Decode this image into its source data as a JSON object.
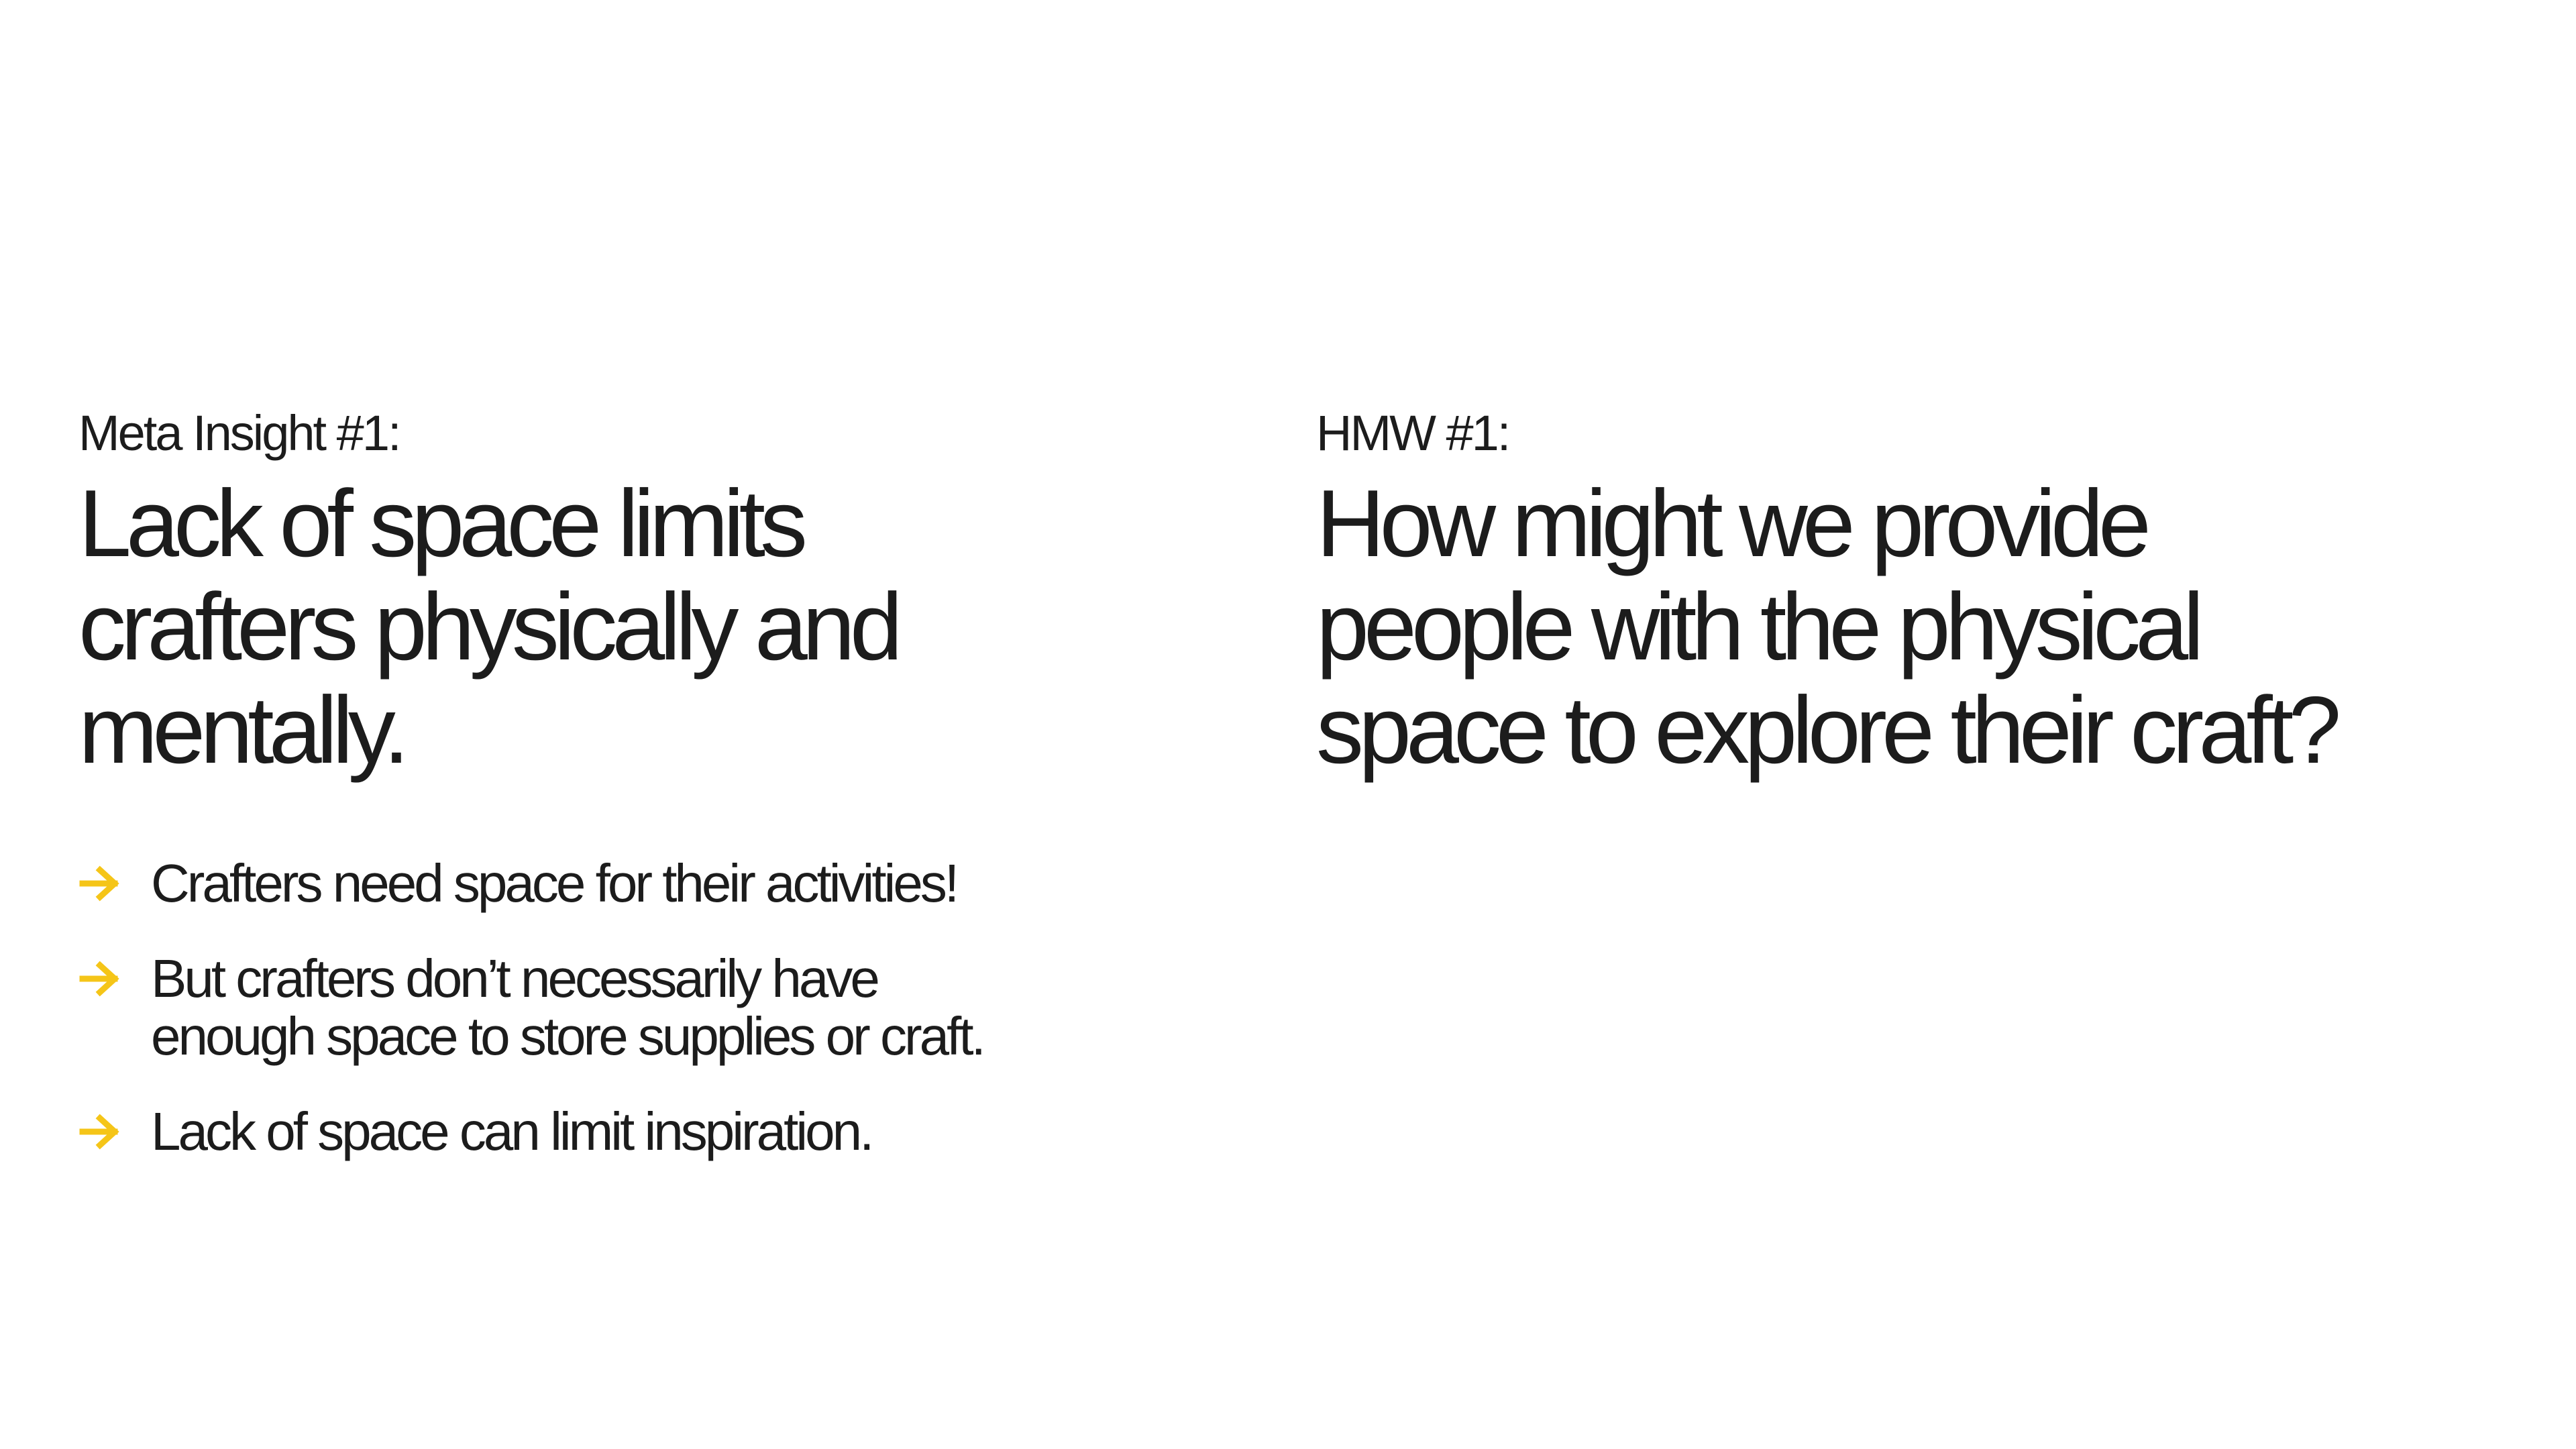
{
  "colors": {
    "text": "#1c1c1c",
    "accent": "#f5c518",
    "background": "#ffffff"
  },
  "left": {
    "eyebrow": "Meta Insight #1:",
    "headline_lines": [
      "Lack of space limits",
      "crafters physically and",
      "mentally."
    ],
    "bullet_icon": "arrow-right-icon",
    "bullets": [
      {
        "lines": [
          "Crafters need space for their activities!"
        ]
      },
      {
        "lines": [
          "But crafters don’t necessarily have",
          "enough space to store supplies or craft."
        ]
      },
      {
        "lines": [
          "Lack of space can limit inspiration."
        ]
      }
    ]
  },
  "right": {
    "eyebrow": "HMW #1:",
    "headline_lines": [
      "How might we provide",
      "people with the physical",
      "space to explore their craft?"
    ]
  }
}
